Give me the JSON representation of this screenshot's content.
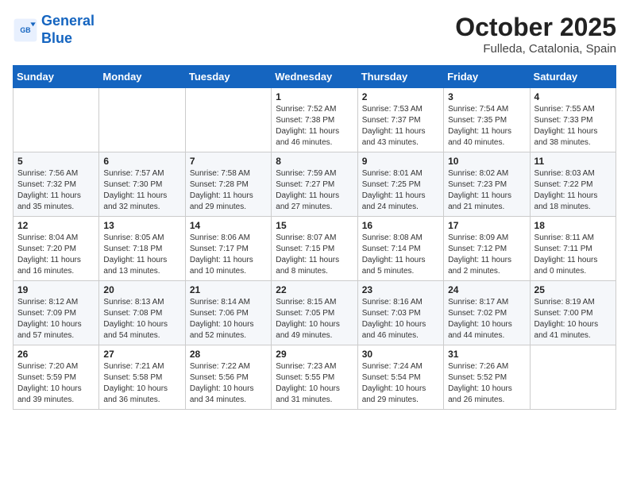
{
  "header": {
    "logo_line1": "General",
    "logo_line2": "Blue",
    "month": "October 2025",
    "location": "Fulleda, Catalonia, Spain"
  },
  "weekdays": [
    "Sunday",
    "Monday",
    "Tuesday",
    "Wednesday",
    "Thursday",
    "Friday",
    "Saturday"
  ],
  "weeks": [
    [
      {
        "day": "",
        "info": ""
      },
      {
        "day": "",
        "info": ""
      },
      {
        "day": "",
        "info": ""
      },
      {
        "day": "1",
        "info": "Sunrise: 7:52 AM\nSunset: 7:38 PM\nDaylight: 11 hours and 46 minutes."
      },
      {
        "day": "2",
        "info": "Sunrise: 7:53 AM\nSunset: 7:37 PM\nDaylight: 11 hours and 43 minutes."
      },
      {
        "day": "3",
        "info": "Sunrise: 7:54 AM\nSunset: 7:35 PM\nDaylight: 11 hours and 40 minutes."
      },
      {
        "day": "4",
        "info": "Sunrise: 7:55 AM\nSunset: 7:33 PM\nDaylight: 11 hours and 38 minutes."
      }
    ],
    [
      {
        "day": "5",
        "info": "Sunrise: 7:56 AM\nSunset: 7:32 PM\nDaylight: 11 hours and 35 minutes."
      },
      {
        "day": "6",
        "info": "Sunrise: 7:57 AM\nSunset: 7:30 PM\nDaylight: 11 hours and 32 minutes."
      },
      {
        "day": "7",
        "info": "Sunrise: 7:58 AM\nSunset: 7:28 PM\nDaylight: 11 hours and 29 minutes."
      },
      {
        "day": "8",
        "info": "Sunrise: 7:59 AM\nSunset: 7:27 PM\nDaylight: 11 hours and 27 minutes."
      },
      {
        "day": "9",
        "info": "Sunrise: 8:01 AM\nSunset: 7:25 PM\nDaylight: 11 hours and 24 minutes."
      },
      {
        "day": "10",
        "info": "Sunrise: 8:02 AM\nSunset: 7:23 PM\nDaylight: 11 hours and 21 minutes."
      },
      {
        "day": "11",
        "info": "Sunrise: 8:03 AM\nSunset: 7:22 PM\nDaylight: 11 hours and 18 minutes."
      }
    ],
    [
      {
        "day": "12",
        "info": "Sunrise: 8:04 AM\nSunset: 7:20 PM\nDaylight: 11 hours and 16 minutes."
      },
      {
        "day": "13",
        "info": "Sunrise: 8:05 AM\nSunset: 7:18 PM\nDaylight: 11 hours and 13 minutes."
      },
      {
        "day": "14",
        "info": "Sunrise: 8:06 AM\nSunset: 7:17 PM\nDaylight: 11 hours and 10 minutes."
      },
      {
        "day": "15",
        "info": "Sunrise: 8:07 AM\nSunset: 7:15 PM\nDaylight: 11 hours and 8 minutes."
      },
      {
        "day": "16",
        "info": "Sunrise: 8:08 AM\nSunset: 7:14 PM\nDaylight: 11 hours and 5 minutes."
      },
      {
        "day": "17",
        "info": "Sunrise: 8:09 AM\nSunset: 7:12 PM\nDaylight: 11 hours and 2 minutes."
      },
      {
        "day": "18",
        "info": "Sunrise: 8:11 AM\nSunset: 7:11 PM\nDaylight: 11 hours and 0 minutes."
      }
    ],
    [
      {
        "day": "19",
        "info": "Sunrise: 8:12 AM\nSunset: 7:09 PM\nDaylight: 10 hours and 57 minutes."
      },
      {
        "day": "20",
        "info": "Sunrise: 8:13 AM\nSunset: 7:08 PM\nDaylight: 10 hours and 54 minutes."
      },
      {
        "day": "21",
        "info": "Sunrise: 8:14 AM\nSunset: 7:06 PM\nDaylight: 10 hours and 52 minutes."
      },
      {
        "day": "22",
        "info": "Sunrise: 8:15 AM\nSunset: 7:05 PM\nDaylight: 10 hours and 49 minutes."
      },
      {
        "day": "23",
        "info": "Sunrise: 8:16 AM\nSunset: 7:03 PM\nDaylight: 10 hours and 46 minutes."
      },
      {
        "day": "24",
        "info": "Sunrise: 8:17 AM\nSunset: 7:02 PM\nDaylight: 10 hours and 44 minutes."
      },
      {
        "day": "25",
        "info": "Sunrise: 8:19 AM\nSunset: 7:00 PM\nDaylight: 10 hours and 41 minutes."
      }
    ],
    [
      {
        "day": "26",
        "info": "Sunrise: 7:20 AM\nSunset: 5:59 PM\nDaylight: 10 hours and 39 minutes."
      },
      {
        "day": "27",
        "info": "Sunrise: 7:21 AM\nSunset: 5:58 PM\nDaylight: 10 hours and 36 minutes."
      },
      {
        "day": "28",
        "info": "Sunrise: 7:22 AM\nSunset: 5:56 PM\nDaylight: 10 hours and 34 minutes."
      },
      {
        "day": "29",
        "info": "Sunrise: 7:23 AM\nSunset: 5:55 PM\nDaylight: 10 hours and 31 minutes."
      },
      {
        "day": "30",
        "info": "Sunrise: 7:24 AM\nSunset: 5:54 PM\nDaylight: 10 hours and 29 minutes."
      },
      {
        "day": "31",
        "info": "Sunrise: 7:26 AM\nSunset: 5:52 PM\nDaylight: 10 hours and 26 minutes."
      },
      {
        "day": "",
        "info": ""
      }
    ]
  ]
}
